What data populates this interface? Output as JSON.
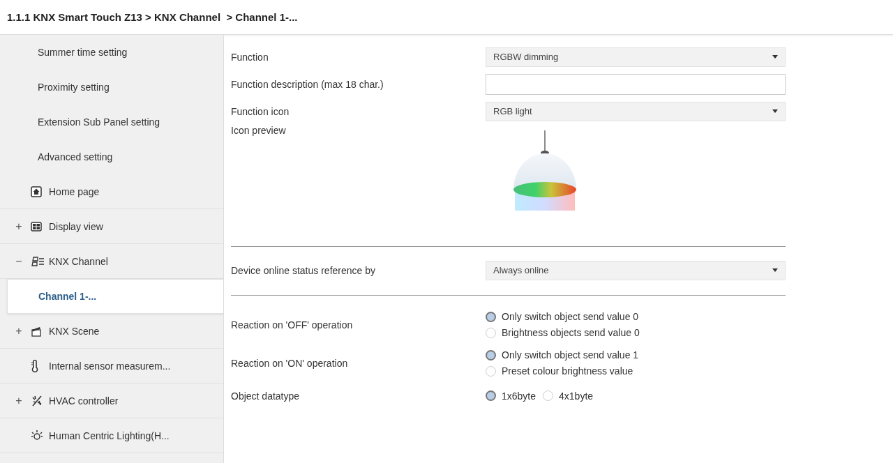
{
  "breadcrumb": "1.1.1 KNX Smart Touch Z13 > KNX Channel  > Channel 1-...",
  "sidebar": {
    "items": [
      {
        "label": "Summer time setting",
        "kind": "plain",
        "selected": false
      },
      {
        "label": "Proximity setting",
        "kind": "plain",
        "selected": false
      },
      {
        "label": "Extension Sub Panel setting",
        "kind": "plain",
        "selected": false
      },
      {
        "label": "Advanced setting",
        "kind": "plain",
        "selected": false
      },
      {
        "label": "Home page",
        "kind": "home",
        "selected": false
      },
      {
        "label": "Display view",
        "kind": "display",
        "expander": "+",
        "selected": false
      },
      {
        "label": "KNX Channel",
        "kind": "channel",
        "expander": "−",
        "selected": false
      },
      {
        "label": "Channel 1-...",
        "kind": "plain",
        "selected": true
      },
      {
        "label": "KNX Scene",
        "kind": "scene",
        "expander": "+",
        "selected": false
      },
      {
        "label": "Internal sensor measurem...",
        "kind": "sensor",
        "selected": false
      },
      {
        "label": "HVAC controller",
        "kind": "hvac",
        "expander": "+",
        "selected": false
      },
      {
        "label": "Human Centric Lighting(H...",
        "kind": "lighting",
        "selected": false
      }
    ]
  },
  "parameters": [
    {
      "kind": "dropdown",
      "label": "Function",
      "value": "RGBW dimming"
    },
    {
      "kind": "text",
      "label": "Function description (max 18 char.)"
    },
    {
      "kind": "dropdown",
      "label": "Function icon",
      "value": "RGB light"
    },
    {
      "kind": "preview",
      "label": "Icon preview"
    },
    {
      "kind": "divider"
    },
    {
      "kind": "dropdown",
      "label": "Device online status reference by",
      "value": "Always online"
    },
    {
      "kind": "divider"
    },
    {
      "kind": "radio",
      "label": "Reaction on 'OFF' operation",
      "options": [
        {
          "label": "Only switch object send value 0",
          "selected": true
        },
        {
          "label": "Brightness objects send value 0",
          "selected": false
        }
      ]
    },
    {
      "kind": "radio",
      "label": "Reaction on 'ON' operation",
      "options": [
        {
          "label": "Only switch object send value 1",
          "selected": true
        },
        {
          "label": "Preset colour brightness value",
          "selected": false
        }
      ]
    },
    {
      "kind": "radio_inline",
      "label": "Object datatype",
      "options": [
        {
          "label": "1x6byte",
          "selected": true
        },
        {
          "label": "4x1byte",
          "selected": false
        }
      ]
    }
  ]
}
